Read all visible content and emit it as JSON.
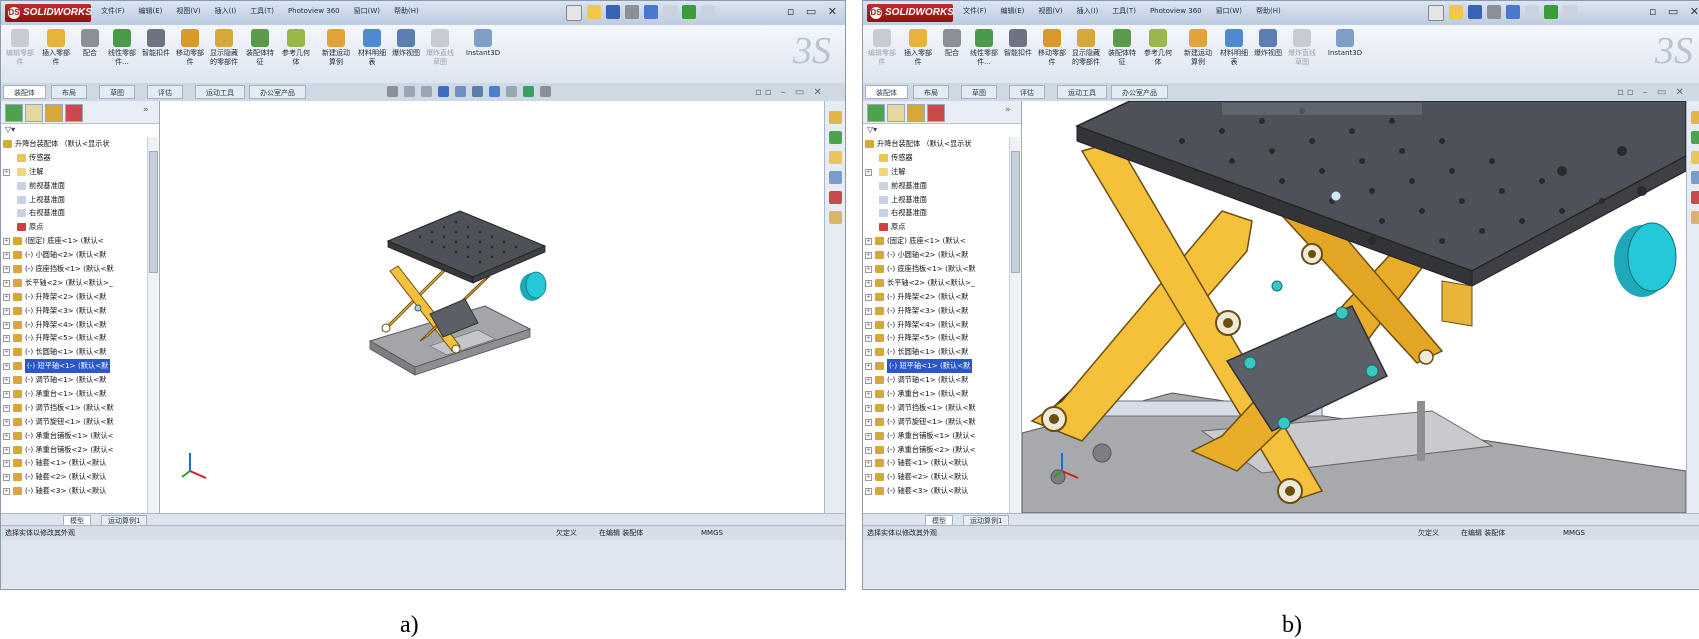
{
  "app": {
    "logo_text": "SOLIDWORKS"
  },
  "menu": [
    "文件(F)",
    "编辑(E)",
    "视图(V)",
    "插入(I)",
    "工具(T)",
    "Photoview 360",
    "窗口(W)",
    "帮助(H)"
  ],
  "ribbon": {
    "buttons": [
      "编辑零部件",
      "插入零部件",
      "配合",
      "线性零部件...",
      "智能扣件",
      "移动零部件",
      "显示隐藏的零部件",
      "装配体特征",
      "参考几何体",
      "新建运动算例",
      "材料明细表",
      "爆炸视图",
      "爆炸直线草图",
      "Instant3D"
    ]
  },
  "command_tabs": [
    "装配体",
    "布局",
    "草图",
    "评估",
    "运动工具",
    "办公室产品"
  ],
  "tree": {
    "root": "升降台装配体 （默认<显示状",
    "items": [
      {
        "label": "传感器",
        "type": "folder"
      },
      {
        "label": "注解",
        "type": "annotation"
      },
      {
        "label": "前视基准面",
        "type": "plane"
      },
      {
        "label": "上视基准面",
        "type": "plane"
      },
      {
        "label": "右视基准面",
        "type": "plane"
      },
      {
        "label": "原点",
        "type": "origin"
      },
      {
        "label": "(固定) 底座<1> (默认<",
        "type": "part"
      },
      {
        "label": "(-) 小圆轴<2> (默认<默",
        "type": "part"
      },
      {
        "label": "(-) 底座挡板<1> (默认<默",
        "type": "part"
      },
      {
        "label": "长平轴<2> (默认<默认>_",
        "type": "part"
      },
      {
        "label": "(-) 升降架<2> (默认<默",
        "type": "part"
      },
      {
        "label": "(-) 升降架<3> (默认<默",
        "type": "part"
      },
      {
        "label": "(-) 升降架<4> (默认<默",
        "type": "part"
      },
      {
        "label": "(-) 升降架<5> (默认<默",
        "type": "part"
      },
      {
        "label": "(-) 长圆轴<1> (默认<默",
        "type": "part"
      },
      {
        "label": "(-) 短平轴<1> (默认<默",
        "type": "part",
        "selected": true
      },
      {
        "label": "(-) 调节轴<1> (默认<默",
        "type": "part"
      },
      {
        "label": "(-) 承重台<1> (默认<默",
        "type": "part"
      },
      {
        "label": "(-) 调节挡板<1> (默认<默",
        "type": "part"
      },
      {
        "label": "(-) 调节旋钮<1> (默认<默",
        "type": "part"
      },
      {
        "label": "(-) 承重台铺板<1> (默认<",
        "type": "part"
      },
      {
        "label": "(-) 承重台铺板<2> (默认<",
        "type": "part"
      },
      {
        "label": "(-) 轴套<1> (默认<默认",
        "type": "part"
      },
      {
        "label": "(-) 轴套<2> (默认<默认",
        "type": "part"
      },
      {
        "label": "(-) 轴套<3> (默认<默认",
        "type": "part"
      }
    ]
  },
  "bottom_tabs": [
    "模型",
    "运动算例1"
  ],
  "status": {
    "left": "选择实体以修改其外观",
    "right1": "欠定义",
    "right2": "在编辑 装配体",
    "right3": "MMGS"
  },
  "captions": {
    "a": "a)",
    "b": "b)"
  },
  "colors": {
    "frame": "#f5c13a",
    "frame_edge": "#6b4e10",
    "table_top": "#4e5157",
    "knob": "#24c8d8",
    "base": "#a3a5a8",
    "selection": "#2b57c9"
  }
}
